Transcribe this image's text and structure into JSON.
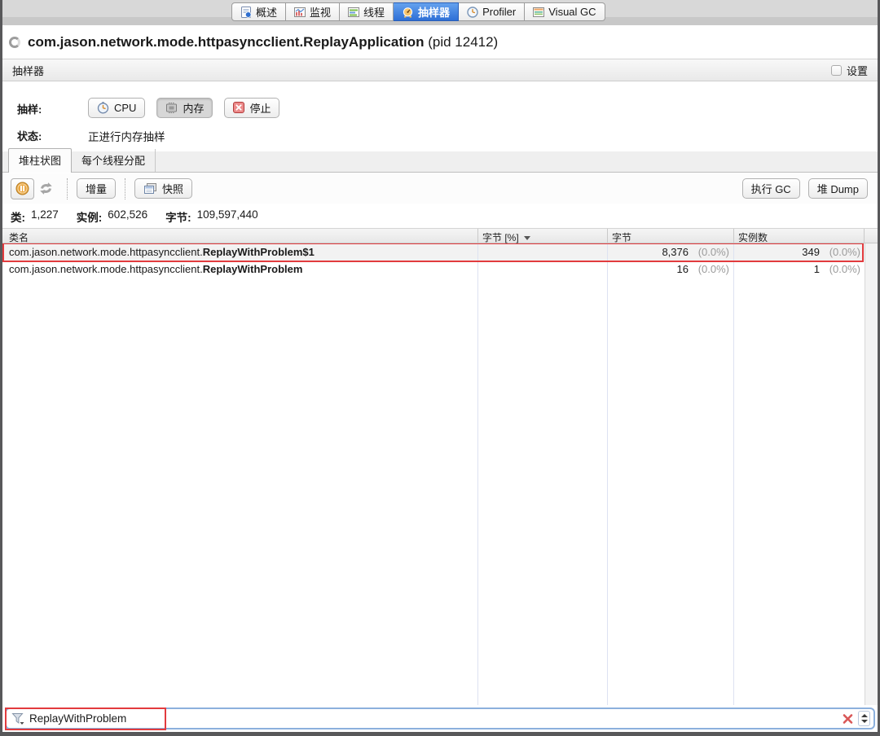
{
  "tabs": {
    "items": [
      {
        "label": "概述"
      },
      {
        "label": "监视"
      },
      {
        "label": "线程"
      },
      {
        "label": "抽样器",
        "selected": true
      },
      {
        "label": "Profiler"
      },
      {
        "label": "Visual GC"
      }
    ]
  },
  "header": {
    "title": "com.jason.network.mode.httpasyncclient.ReplayApplication",
    "pid": "(pid 12412)"
  },
  "sampler": {
    "section_title": "抽样器",
    "settings_label": "设置",
    "sample_label": "抽样:",
    "cpu_button": "CPU",
    "memory_button": "内存",
    "stop_button": "停止",
    "status_label": "状态:",
    "status_value": "正进行内存抽样"
  },
  "view_tabs": {
    "heap_histogram": "堆柱状图",
    "per_thread_alloc": "每个线程分配"
  },
  "toolbar": {
    "delta_button": "增量",
    "snapshot_button": "快照",
    "gc_button": "执行 GC",
    "heap_dump_button": "堆 Dump"
  },
  "summary": {
    "classes_label": "类:",
    "classes_value": "1,227",
    "instances_label": "实例:",
    "instances_value": "602,526",
    "bytes_label": "字节:",
    "bytes_value": "109,597,440"
  },
  "table": {
    "columns": [
      "类名",
      "字节 [%]",
      "字节",
      "实例数"
    ],
    "sort_column": "字节 [%]",
    "sort_direction": "descending",
    "rows": [
      {
        "class_prefix": "com.jason.network.mode.httpasyncclient.",
        "class_name": "ReplayWithProblem$1",
        "bytes": "8,376",
        "bytes_pct": "(0.0%)",
        "instances": "349",
        "instances_pct": "(0.0%)",
        "highlighted": true
      },
      {
        "class_prefix": "com.jason.network.mode.httpasyncclient.",
        "class_name": "ReplayWithProblem",
        "bytes": "16",
        "bytes_pct": "(0.0%)",
        "instances": "1",
        "instances_pct": "(0.0%)",
        "highlighted": false
      }
    ]
  },
  "filter": {
    "value": "ReplayWithProblem"
  },
  "colors": {
    "selected_tab_blue": "#2e6fd6",
    "annotation_red": "#e23b3e",
    "percent_gray": "#9b9b9b",
    "grid_line": "#dde2f1",
    "filter_focus_blue": "#8cb0dd"
  }
}
